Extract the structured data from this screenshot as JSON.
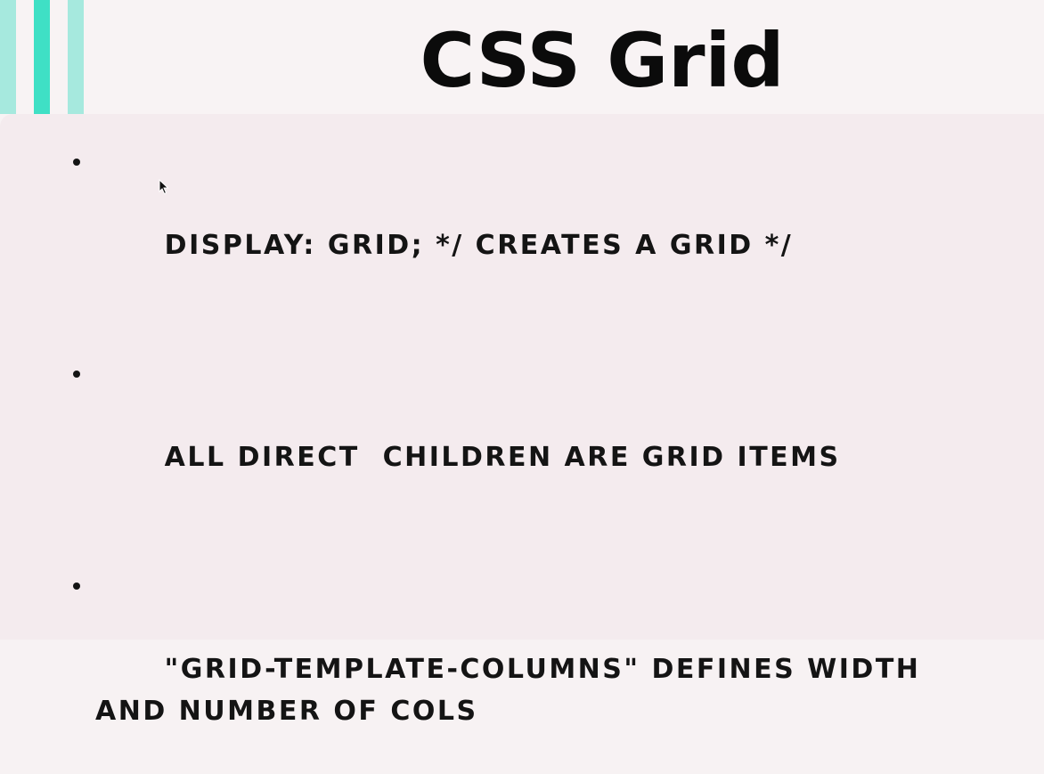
{
  "slide": {
    "title": "CSS Grid",
    "bullets": [
      "DISPLAY: GRID; */ CREATES A GRID */",
      "ALL DIRECT  CHILDREN ARE GRID ITEMS",
      "\"GRID-TEMPLATE-COLUMNS\" DEFINES WIDTH AND NUMBER OF COLS"
    ]
  },
  "colors": {
    "accent_light": "#a6e9de",
    "accent": "#3fe0c5",
    "background": "#f8f3f4",
    "panel": "#f4ebee",
    "text": "#141414"
  },
  "icons": {
    "cursor": "mouse-pointer-icon"
  }
}
